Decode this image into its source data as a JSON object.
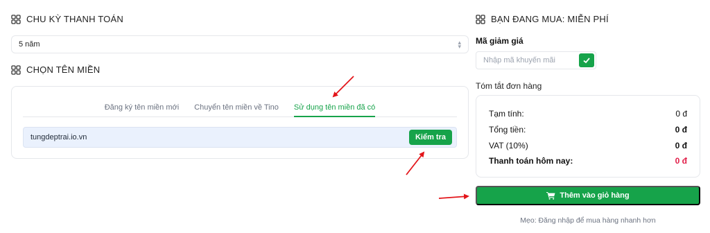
{
  "billing": {
    "title": "CHU KỲ THANH TOÁN",
    "selected_period": "5 năm"
  },
  "domain": {
    "title": "CHỌN TÊN MIỀN",
    "tabs": [
      {
        "label": "Đăng ký tên miền mới",
        "active": false
      },
      {
        "label": "Chuyển tên miền về Tino",
        "active": false
      },
      {
        "label": "Sử dụng tên miền đã có",
        "active": true
      }
    ],
    "input_value": "tungdeptrai.io.vn",
    "check_label": "Kiểm tra"
  },
  "order": {
    "title": "BẠN ĐANG MUA: MIỄN PHÍ",
    "coupon_label": "Mã giảm giá",
    "coupon_placeholder": "Nhập mã khuyến mãi",
    "summary_title": "Tóm tắt đơn hàng",
    "rows": [
      {
        "label": "Tạm tính:",
        "value": "0 đ"
      },
      {
        "label": "Tổng tiền:",
        "value": "0 đ"
      },
      {
        "label": "VAT (10%)",
        "value": "0 đ"
      },
      {
        "label": "Thanh toán hôm nay:",
        "value": "0 đ"
      }
    ],
    "add_to_cart": "Thêm vào giỏ hàng",
    "tip": "Mẹo: Đăng nhập để mua hàng nhanh hơn"
  },
  "icons": {
    "section": "grid-icon",
    "caret": "chevron-up-down-icon",
    "check": "check-icon",
    "cart": "cart-icon",
    "annotation": "red-arrow"
  },
  "colors": {
    "accent": "#16a34a",
    "total_due": "#e11d48",
    "annotation": "#e3151a",
    "input_bg": "#eaf1fd"
  }
}
